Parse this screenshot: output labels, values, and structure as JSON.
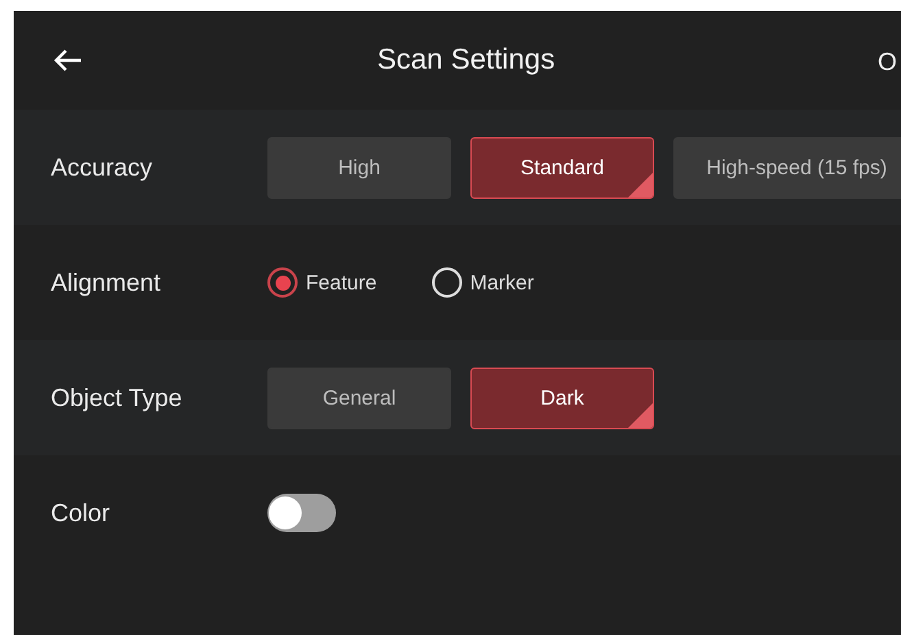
{
  "header": {
    "title": "Scan Settings",
    "action": "O"
  },
  "settings": [
    {
      "label": "Accuracy",
      "kind": "segmented",
      "options": [
        {
          "label": "High",
          "selected": false
        },
        {
          "label": "Standard",
          "selected": true
        },
        {
          "label": "High-speed (15 fps)",
          "selected": false
        }
      ]
    },
    {
      "label": "Alignment",
      "kind": "radio",
      "options": [
        {
          "label": "Feature",
          "selected": true
        },
        {
          "label": "Marker",
          "selected": false
        }
      ]
    },
    {
      "label": "Object Type",
      "kind": "segmented",
      "options": [
        {
          "label": "General",
          "selected": false
        },
        {
          "label": "Dark",
          "selected": true
        }
      ]
    },
    {
      "label": "Color",
      "kind": "toggle",
      "on": false
    }
  ]
}
